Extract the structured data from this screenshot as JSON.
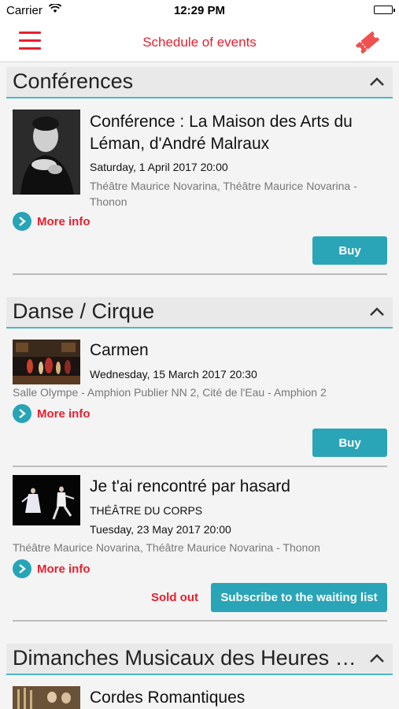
{
  "status_bar": {
    "carrier": "Carrier",
    "time": "12:29 PM"
  },
  "navbar": {
    "title": "Schedule of events"
  },
  "sections": [
    {
      "title": "Conférences",
      "events": [
        {
          "title": "Conférence : La Maison des Arts du Léman, d'André Malraux",
          "date": "Saturday, 1 April 2017 20:00",
          "venue": "Théâtre Maurice Novarina, Théâtre Maurice Novarina - Thonon",
          "more_label": "More info",
          "buy_label": "Buy"
        }
      ]
    },
    {
      "title": "Danse / Cirque",
      "events": [
        {
          "title": "Carmen",
          "date": "Wednesday, 15 March 2017 20:30",
          "venue": "Salle Olympe - Amphion Publier NN 2, Cité de l'Eau - Amphion 2",
          "more_label": "More info",
          "buy_label": "Buy"
        },
        {
          "title": "Je t'ai rencontré par hasard",
          "subtitle": "THÉÂTRE DU CORPS",
          "date": "Tuesday, 23 May 2017 20:00",
          "venue": "Théâtre Maurice Novarina, Théâtre Maurice Novarina - Thonon",
          "more_label": "More info",
          "sold_out_label": "Sold out",
          "waiting_list_label": "Subscribe to the waiting list"
        }
      ]
    },
    {
      "title": "Dimanches Musicaux des Heures Musicales",
      "events": [
        {
          "title": "Cordes Romantiques"
        }
      ]
    }
  ],
  "colors": {
    "accent_red": "#e8202e",
    "accent_teal": "#2aa5b7"
  },
  "icons": [
    "wifi-icon",
    "battery-icon",
    "hamburger-menu-icon",
    "ticket-icon",
    "chevron-up-icon",
    "chevron-right-icon"
  ]
}
